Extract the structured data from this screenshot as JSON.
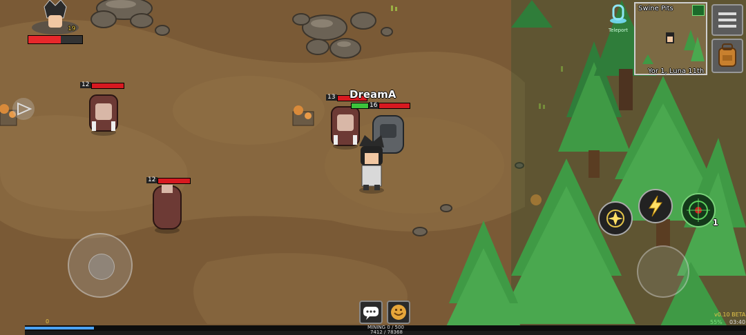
{
  "player": {
    "name": "DreamA",
    "level": "19",
    "hp_fraction": 0.6,
    "bar_level": "16"
  },
  "enemies": [
    {
      "level": "12"
    },
    {
      "level": "13"
    },
    {
      "level": "12"
    }
  ],
  "minimap": {
    "title": "Swine Pits",
    "date": "Yor 1, Luna 11th"
  },
  "teleport_label": "Teleport",
  "skills": {
    "count_badge": "1"
  },
  "bottom": {
    "mining_label": "MINING 0 / 500",
    "xp_text": "7412 / 78368",
    "left_level": "0",
    "version": "v0.10 BETA",
    "battery": "55%",
    "time": "03:40"
  },
  "icons": {
    "menu": "hamburger-icon",
    "inventory": "backpack-icon",
    "fullscreen": "expand-icon",
    "chat": "chat-icon",
    "emote": "smile-icon",
    "teleport": "portal-icon"
  },
  "colors": {
    "ground": "#7a5a36",
    "hp_red": "#d71920",
    "tree_green": "#3f9a45",
    "minimap_bg": "#7c6a44"
  }
}
